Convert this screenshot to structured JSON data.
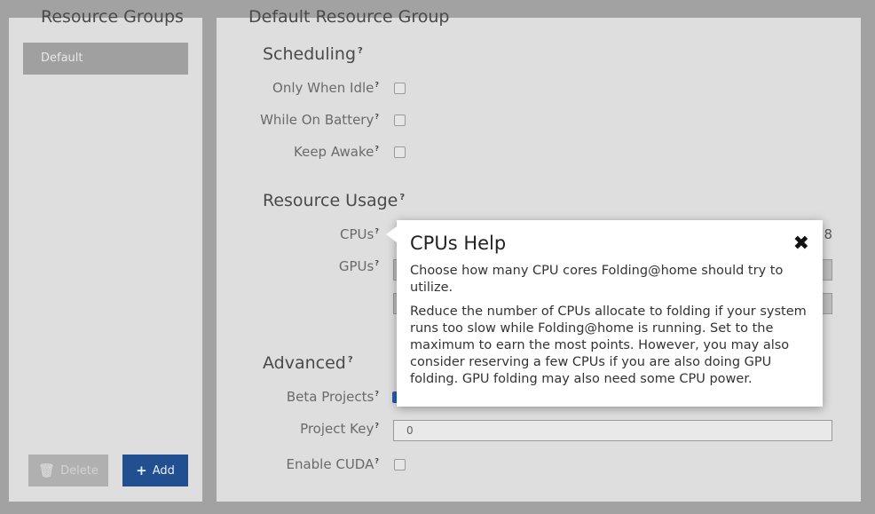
{
  "left": {
    "title": "Resource Groups",
    "groups": [
      {
        "label": "Default"
      }
    ],
    "delete_label": "Delete",
    "add_label": "Add"
  },
  "main": {
    "title": "Default Resource Group",
    "scheduling": {
      "title": "Scheduling",
      "rows": [
        {
          "label": "Only When Idle",
          "checked": false
        },
        {
          "label": "While On Battery",
          "checked": false
        },
        {
          "label": "Keep Awake",
          "checked": false
        }
      ]
    },
    "resource_usage": {
      "title": "Resource Usage",
      "cpus_label": "CPUs",
      "cpus_value": "8",
      "gpus_label": "GPUs"
    },
    "advanced": {
      "title": "Advanced",
      "beta_label": "Beta Projects",
      "beta_checked": true,
      "project_key_label": "Project Key",
      "project_key_value": "0",
      "cuda_label": "Enable CUDA",
      "cuda_checked": false
    }
  },
  "help": {
    "title": "CPUs Help",
    "close_icon": "close-icon",
    "p1": "Choose how many CPU cores Folding@home should try to utilize.",
    "p2": "Reduce the number of CPUs allocate to folding if your system runs too slow while Folding@home is running. Set to the maximum to earn the most points. However, you may also consider reserving a few CPUs if you are also doing GPU folding. GPU folding may also need some CPU power."
  },
  "colors": {
    "background": "#a2a2a2",
    "panel": "#dedede",
    "accent": "#224f8f"
  }
}
